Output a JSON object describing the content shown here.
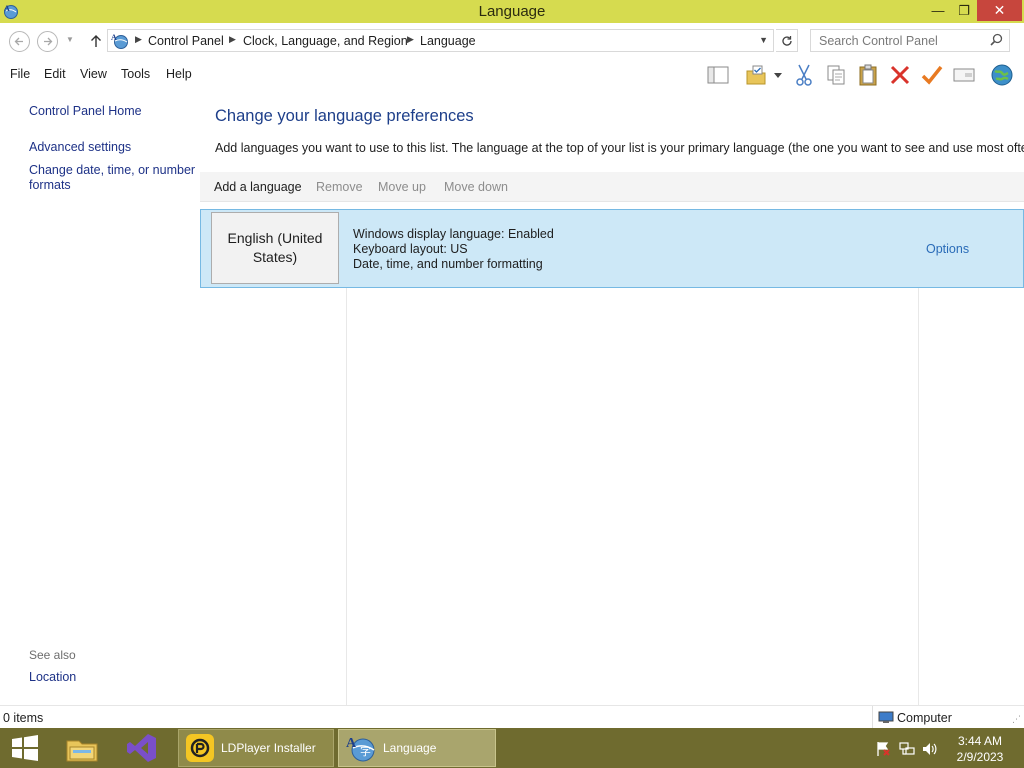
{
  "window": {
    "title": "Language",
    "min_glyph": "—",
    "max_glyph": "❐",
    "close_glyph": "✕"
  },
  "address": {
    "breadcrumbs": [
      "Control Panel",
      "Clock, Language, and Region",
      "Language"
    ],
    "search_placeholder": "Search Control Panel"
  },
  "menu": [
    "File",
    "Edit",
    "View",
    "Tools",
    "Help"
  ],
  "toolbar_icons": [
    "layout-icon",
    "folder-check-icon",
    "cut-icon",
    "copy-icon",
    "paste-icon",
    "delete-icon",
    "checkmark-icon",
    "properties-icon",
    "globe-icon"
  ],
  "sidebar": {
    "home": "Control Panel Home",
    "links": [
      "Advanced settings",
      "Change date, time, or number formats"
    ],
    "see_also_label": "See also",
    "see_also_links": [
      "Location"
    ]
  },
  "main": {
    "heading": "Change your language preferences",
    "description": "Add languages you want to use to this list. The language at the top of your list is your primary language (the one you want to see and use most often).",
    "commands": {
      "add": "Add a language",
      "remove": "Remove",
      "move_up": "Move up",
      "move_down": "Move down"
    },
    "languages": [
      {
        "name": "English (United States)",
        "details": [
          "Windows display language: Enabled",
          "Keyboard layout: US",
          "Date, time, and number formatting"
        ],
        "options_label": "Options"
      }
    ]
  },
  "status": {
    "items": "0 items",
    "location": "Computer"
  },
  "taskbar": {
    "apps": [
      {
        "name": "start-button",
        "label": ""
      },
      {
        "name": "file-explorer",
        "label": ""
      },
      {
        "name": "visual-studio",
        "label": ""
      },
      {
        "name": "ldplayer-installer",
        "label": "LDPlayer Installer"
      },
      {
        "name": "language",
        "label": "Language"
      }
    ],
    "time": "3:44 AM",
    "date": "2/9/2023"
  },
  "colors": {
    "title_bar": "#d6db4f",
    "taskbar": "#6f6b2f",
    "selection": "#cde8f7",
    "link": "#1e3287",
    "heading": "#1e3f8a"
  }
}
